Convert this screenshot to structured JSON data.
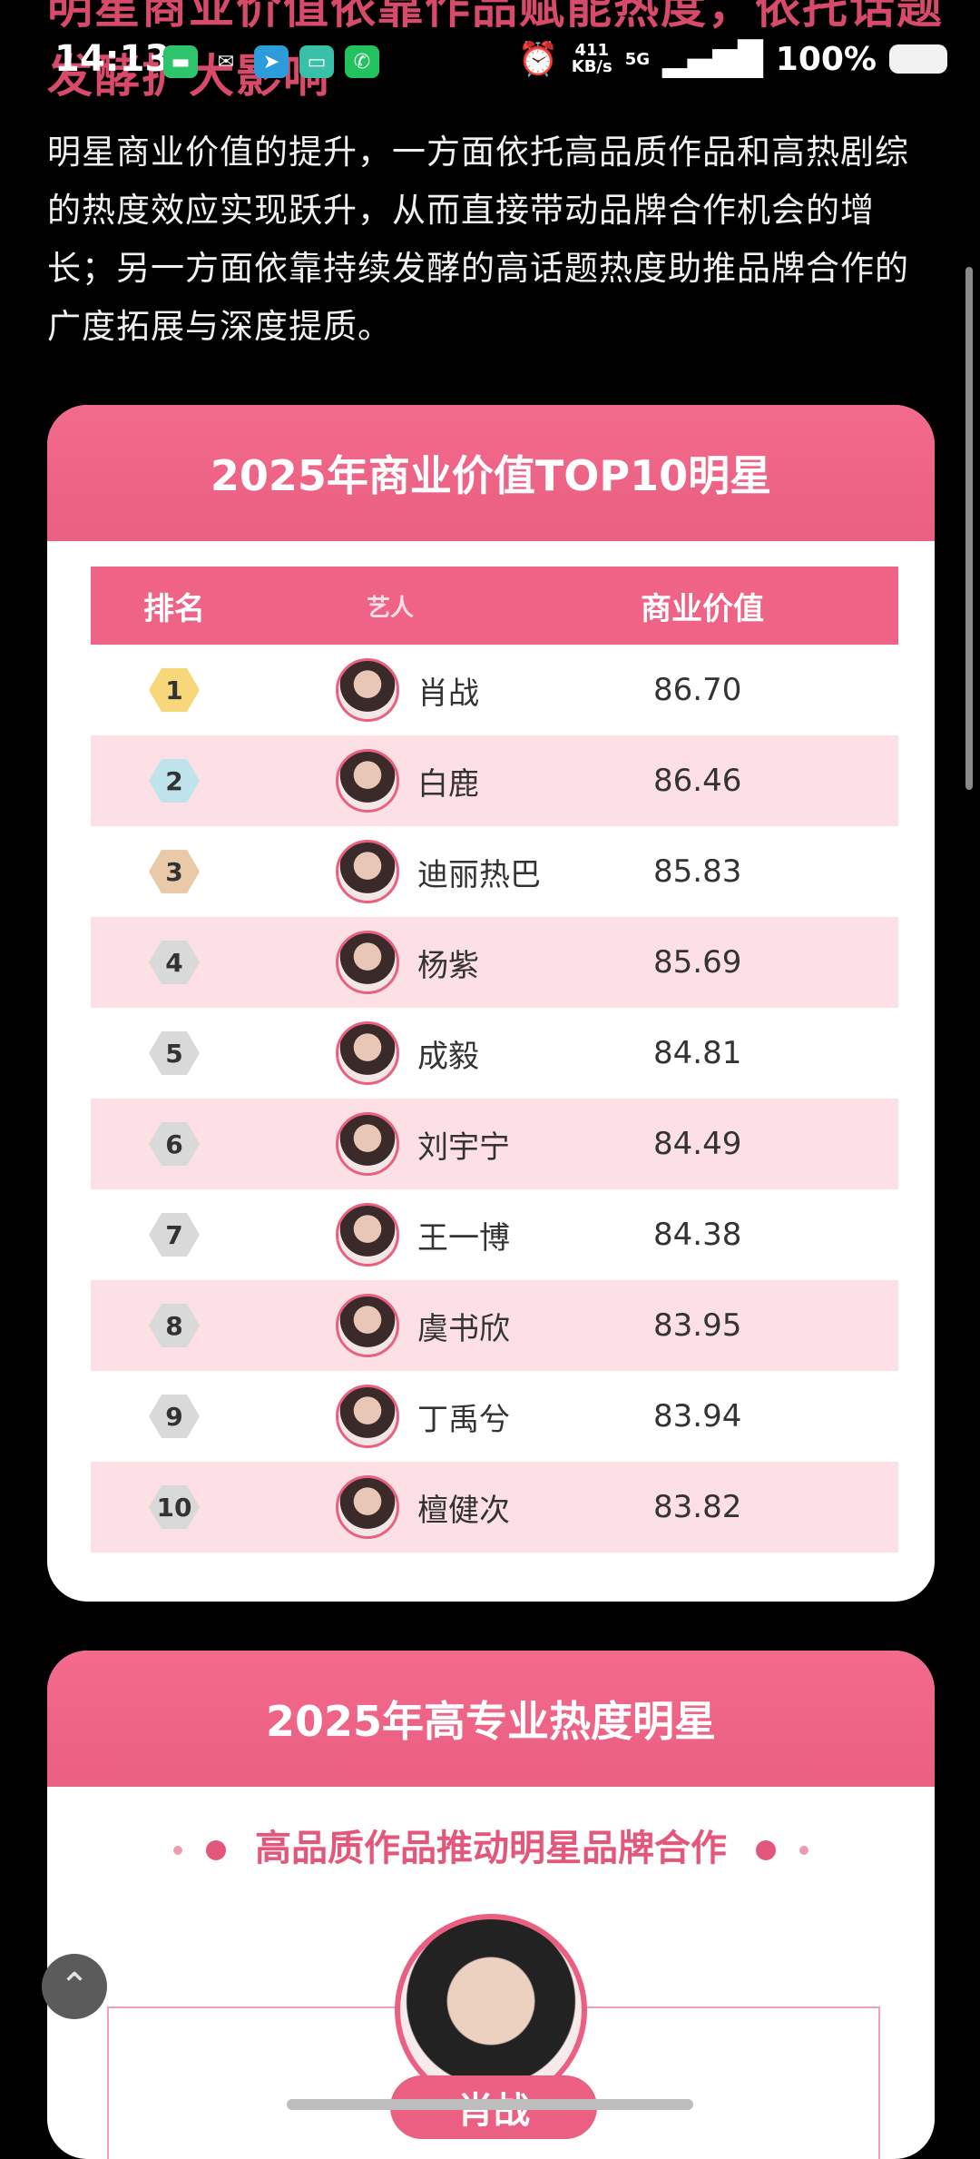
{
  "status_bar": {
    "time": "14:13",
    "speed_value": "411",
    "speed_unit": "KB/s",
    "network": "5G",
    "battery": "100%",
    "icons": [
      "chat-icon",
      "mail-icon",
      "telegram-icon",
      "message-icon",
      "phone-icon",
      "alarm-icon",
      "signal-icon",
      "battery-icon"
    ]
  },
  "article": {
    "partial_heading": "明星商业价值依靠作品赋能热度，依托话题发酵扩大影响",
    "intro": "明星商业价值的提升，一方面依托高品质作品和高热剧综的热度效应实现跃升，从而直接带动品牌合作机会的增长；另一方面依靠持续发酵的高话题热度助推品牌合作的广度拓展与深度提质。"
  },
  "top10_card": {
    "title": "2025年商业价值TOP10明星",
    "headers": {
      "rank": "排名",
      "name": "艺人",
      "value": "商业价值"
    },
    "rows": [
      {
        "rank": "1",
        "name": "肖战",
        "value": "86.70"
      },
      {
        "rank": "2",
        "name": "白鹿",
        "value": "86.46"
      },
      {
        "rank": "3",
        "name": "迪丽热巴",
        "value": "85.83"
      },
      {
        "rank": "4",
        "name": "杨紫",
        "value": "85.69"
      },
      {
        "rank": "5",
        "name": "成毅",
        "value": "84.81"
      },
      {
        "rank": "6",
        "name": "刘宇宁",
        "value": "84.49"
      },
      {
        "rank": "7",
        "name": "王一博",
        "value": "84.38"
      },
      {
        "rank": "8",
        "name": "虞书欣",
        "value": "83.95"
      },
      {
        "rank": "9",
        "name": "丁禹兮",
        "value": "83.94"
      },
      {
        "rank": "10",
        "name": "檀健次",
        "value": "83.82"
      }
    ],
    "colors": {
      "gold": "#f7d779",
      "silver": "#bfe3ea",
      "bronze": "#e9c9a6",
      "default": "#d9d9d9"
    }
  },
  "second_card": {
    "title": "2025年高专业热度明星",
    "subtitle": "高品质作品推动明星品牌合作",
    "featured_name": "肖战"
  }
}
